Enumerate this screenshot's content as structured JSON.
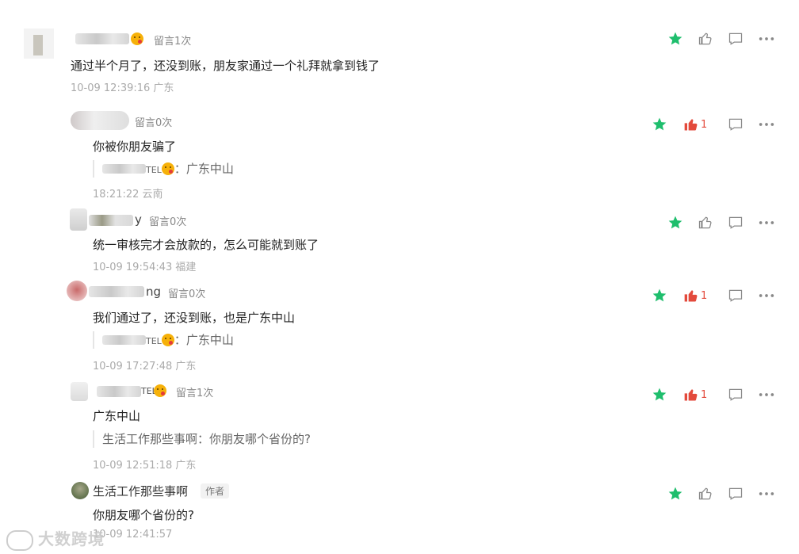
{
  "comments": [
    {
      "count_label": "留言1次",
      "text": "通过半个月了，还没到账，朋友家通过一个礼拜就拿到钱了",
      "time": "10-09 12:39:16 广东",
      "like_count": "",
      "starred": true
    },
    {
      "count_label": "留言0次",
      "text": "你被你朋友骗了",
      "quote_suffix": "TEL",
      "quote_text": "：广东中山",
      "time": "18:21:22 云南",
      "like_count": "1",
      "starred": true
    },
    {
      "name_tail": "y",
      "count_label": "留言0次",
      "text": "统一审核完才会放款的，怎么可能就到账了",
      "time": "10-09 19:54:43 福建",
      "like_count": "",
      "starred": true
    },
    {
      "name_tail": "ng",
      "count_label": "留言0次",
      "text": "我们通过了，还没到账，也是广东中山",
      "quote_suffix": "TEL",
      "quote_text": "：广东中山",
      "time": "10-09 17:27:48 广东",
      "like_count": "1",
      "starred": true
    },
    {
      "name_suffix": "TEL",
      "count_label": "留言1次",
      "text": "广东中山",
      "quote_text": "生活工作那些事啊：你朋友哪个省份的?",
      "time": "10-09 12:51:18 广东",
      "like_count": "1",
      "starred": true
    },
    {
      "name": "生活工作那些事啊",
      "badge": "作者",
      "text": "你朋友哪个省份的?",
      "time": "10-09 12:41:57",
      "like_count": "",
      "starred": true
    }
  ],
  "watermark": "大数跨境",
  "colors": {
    "star": "#1fbe6d",
    "like_active": "#e34a3c",
    "icon_gray": "#888888"
  },
  "icons": [
    "star-icon",
    "thumb-up-icon",
    "comment-icon",
    "more-icon"
  ]
}
